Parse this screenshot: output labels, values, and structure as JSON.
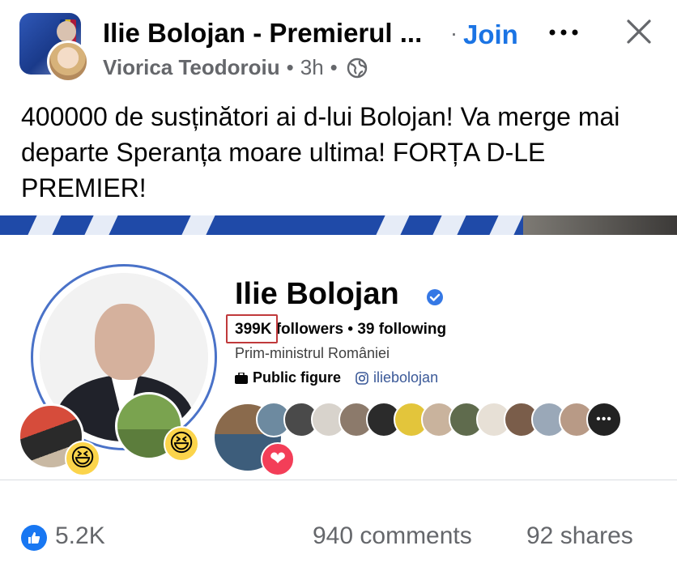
{
  "header": {
    "group_name": "Ilie Bolojan - Premierul ...",
    "join_separator": "·",
    "join_label": "Join",
    "author": "Viorica Teodoroiu",
    "dot": "•",
    "time": "3h",
    "privacy_icon": "globe-icon"
  },
  "post": {
    "text": "400000 de susținători ai d-lui Bolojan! Va merge mai departe Speranța moare ultima! FORȚA D-LE PREMIER!"
  },
  "image": {
    "profile_name": "Ilie Bolojan",
    "followers_count": "399K",
    "followers_label": "followers",
    "following_text": "• 39 following",
    "title": "Prim-ministrul României",
    "category": "Public figure",
    "instagram_handle": "iliebolojan",
    "more_indicator": "•••",
    "reaction_emojis": [
      "😆",
      "😆",
      "❤"
    ],
    "highlight_color": "#c0393b",
    "verified_color": "#3578e5"
  },
  "footer": {
    "likes": "5.2K",
    "comments": "940 comments",
    "shares": "92 shares"
  },
  "colors": {
    "join": "#1b74e4",
    "secondary_text": "#65676b",
    "like_blue": "#1877f2"
  }
}
